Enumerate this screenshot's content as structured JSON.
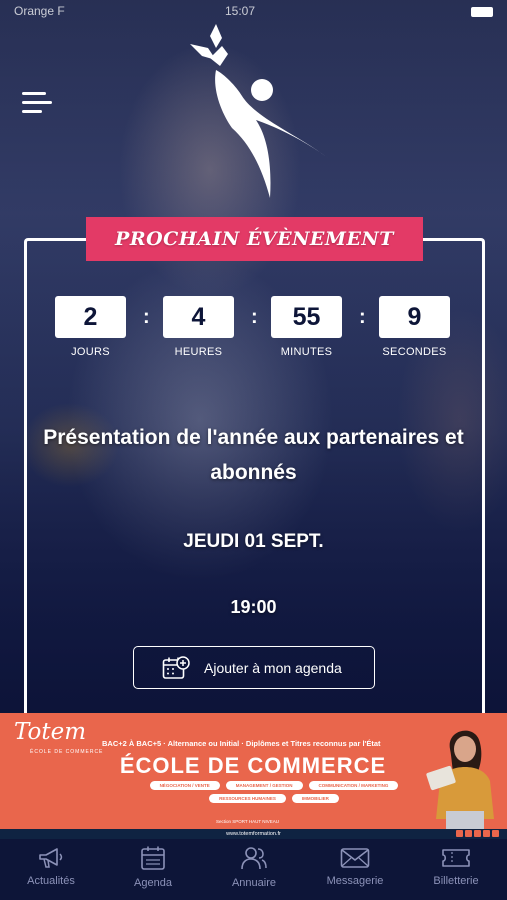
{
  "status_bar": {
    "carrier": "Orange F",
    "time": "15:07"
  },
  "header": {
    "menu_icon": "hamburger-icon",
    "logo_icon": "club-logo-icon"
  },
  "event": {
    "banner": "PROCHAIN ÉVÈNEMENT",
    "countdown": [
      {
        "value": "2",
        "label": "JOURS"
      },
      {
        "value": "4",
        "label": "HEURES"
      },
      {
        "value": "55",
        "label": "MINUTES"
      },
      {
        "value": "9",
        "label": "SECONDES"
      }
    ],
    "separator": ":",
    "title_line1": "Présentation de l'année aux partenaires et",
    "title_line2": "abonnés",
    "date": "JEUDI 01 SEPT.",
    "time": "19:00",
    "agenda_button": "Ajouter à mon agenda",
    "agenda_icon": "calendar-add-icon"
  },
  "ad": {
    "brand": "Totem",
    "brand_sub": "ÉCOLE DE COMMERCE",
    "tagline": "BAC+2 À BAC+5 · Alternance ou Initial · Diplômes et Titres reconnus par l'État",
    "headline": "ÉCOLE DE COMMERCE",
    "tags": [
      "NÉGOCIATION / VENTE",
      "MANAGEMENT / GESTION",
      "COMMUNICATION / MARKETING",
      "RESSOURCES HUMAINES",
      "IMMOBILIER"
    ],
    "location": "Section SPORT HAUT NIVEAU",
    "website": "www.totemformation.fr",
    "accent": "#e9664c"
  },
  "tabs": [
    {
      "label": "Actualités",
      "icon": "megaphone-icon"
    },
    {
      "label": "Agenda",
      "icon": "calendar-icon"
    },
    {
      "label": "Annuaire",
      "icon": "people-icon"
    },
    {
      "label": "Messagerie",
      "icon": "envelope-icon"
    },
    {
      "label": "Billetterie",
      "icon": "ticket-icon"
    }
  ],
  "colors": {
    "banner": "#e33a66",
    "background": "#0d1538",
    "tab_inactive": "#8c92b8"
  }
}
